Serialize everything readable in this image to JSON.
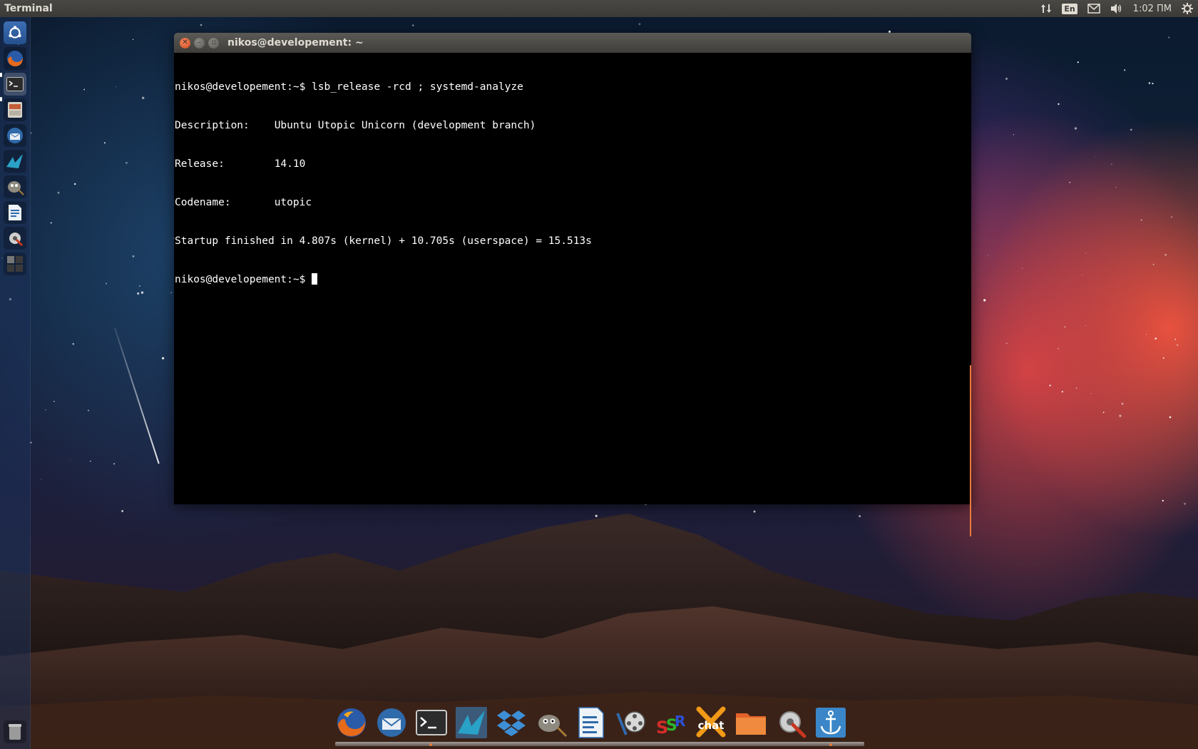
{
  "top_panel": {
    "app_title": "Terminal",
    "keyboard_layout": "En",
    "clock": "1:02 ПМ",
    "icons": [
      "network-updown-icon",
      "keyboard-layout-icon",
      "mail-envelope-icon",
      "volume-icon",
      "clock",
      "session-gear-icon"
    ]
  },
  "launcher": {
    "items": [
      "ubuntu-dash-icon",
      "firefox-icon",
      "terminal-icon",
      "files-cabinet-icon",
      "thunderbird-icon",
      "synapse-bird-icon",
      "gimp-icon",
      "libreoffice-writer-icon",
      "system-settings-icon",
      "workspace-switcher-icon",
      "trash-icon"
    ]
  },
  "window": {
    "title": "nikos@developement: ~",
    "lines": [
      "nikos@developement:~$ lsb_release -rcd ; systemd-analyze",
      "Description:\tUbuntu Utopic Unicorn (development branch)",
      "Release:\t14.10",
      "Codename:\tutopic",
      "Startup finished in 4.807s (kernel) + 10.705s (userspace) = 15.513s"
    ],
    "prompt": "nikos@developement:~$ "
  },
  "dock": {
    "items": [
      "firefox-icon",
      "thunderbird-icon",
      "terminal-icon",
      "synapse-bird-icon",
      "dropbox-icon",
      "gimp-icon",
      "libreoffice-writer-icon",
      "video-editor-icon",
      "simplescreenrecorder-icon",
      "xchat-icon",
      "files-folder-icon",
      "system-tools-icon",
      "anchor-icon"
    ],
    "ssr_label": "SSR",
    "xchat_label": "chat"
  },
  "colors": {
    "terminal_bg": "#000000",
    "terminal_fg": "#ffffff",
    "accent_orange": "#e77b3b",
    "panel_bg": "#3b3a37"
  }
}
